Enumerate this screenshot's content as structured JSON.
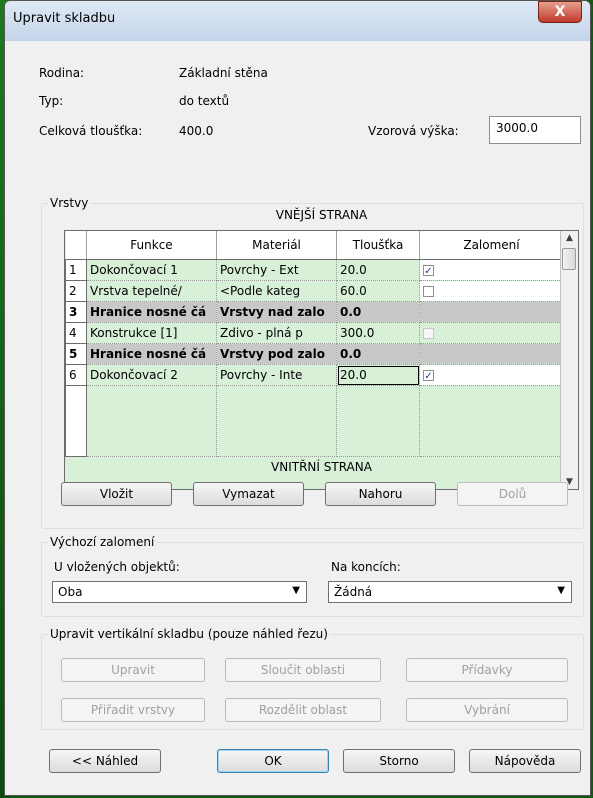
{
  "window": {
    "title": "Upravit skladbu",
    "close_glyph": "X"
  },
  "info": {
    "rodina_label": "Rodina:",
    "rodina_value": "Základní stěna",
    "typ_label": "Typ:",
    "typ_value": "do textů",
    "thickness_label": "Celková tloušťka:",
    "thickness_value": "400.0",
    "sample_height_label": "Vzorová výška:",
    "sample_height_value": "3000.0"
  },
  "layers": {
    "group_label": "Vrstvy",
    "exterior_label": "VNĚJŠÍ STRANA",
    "interior_label": "VNITŘNÍ STRANA",
    "columns": [
      "",
      "Funkce",
      "Materiál",
      "Tloušťka",
      "Zalomení"
    ],
    "rows": [
      {
        "num": "1",
        "function": "Dokončovací 1",
        "material": "Povrchy - Ext",
        "thickness": "20.0",
        "wrap": true,
        "core": false
      },
      {
        "num": "2",
        "function": "Vrstva tepelné/",
        "material": "<Podle kateg",
        "thickness": "60.0",
        "wrap": false,
        "core": false
      },
      {
        "num": "3",
        "function": "Hranice nosné čá",
        "material": "Vrstvy nad zalo",
        "thickness": "0.0",
        "wrap": null,
        "core": true
      },
      {
        "num": "4",
        "function": "Konstrukce [1]",
        "material": "Zdivo - plná p",
        "thickness": "300.0",
        "wrap": false,
        "core": false
      },
      {
        "num": "5",
        "function": "Hranice nosné čá",
        "material": "Vrstvy pod zalo",
        "thickness": "0.0",
        "wrap": null,
        "core": true
      },
      {
        "num": "6",
        "function": "Dokončovací 2",
        "material": "Povrchy - Inte",
        "thickness": "20.0",
        "wrap": true,
        "core": false
      }
    ],
    "buttons": {
      "insert": "Vložit",
      "delete": "Vymazat",
      "up": "Nahoru",
      "down": "Dolů"
    }
  },
  "default_wrap": {
    "group_label": "Výchozí zalomení",
    "inserts_label": "U vložených objektů:",
    "inserts_value": "Oba",
    "ends_label": "Na koncích:",
    "ends_value": "Žádná"
  },
  "vertical": {
    "group_label": "Upravit vertikální skladbu (pouze náhled řezu)",
    "buttons": {
      "modify": "Upravit",
      "merge": "Sloučit oblasti",
      "sweeps": "Přídavky",
      "assign": "Přiřadit vrstvy",
      "split": "Rozdělit oblast",
      "reveals": "Vybrání"
    }
  },
  "footer": {
    "preview": "<< Náhled",
    "ok": "OK",
    "cancel": "Storno",
    "help": "Nápověda"
  }
}
